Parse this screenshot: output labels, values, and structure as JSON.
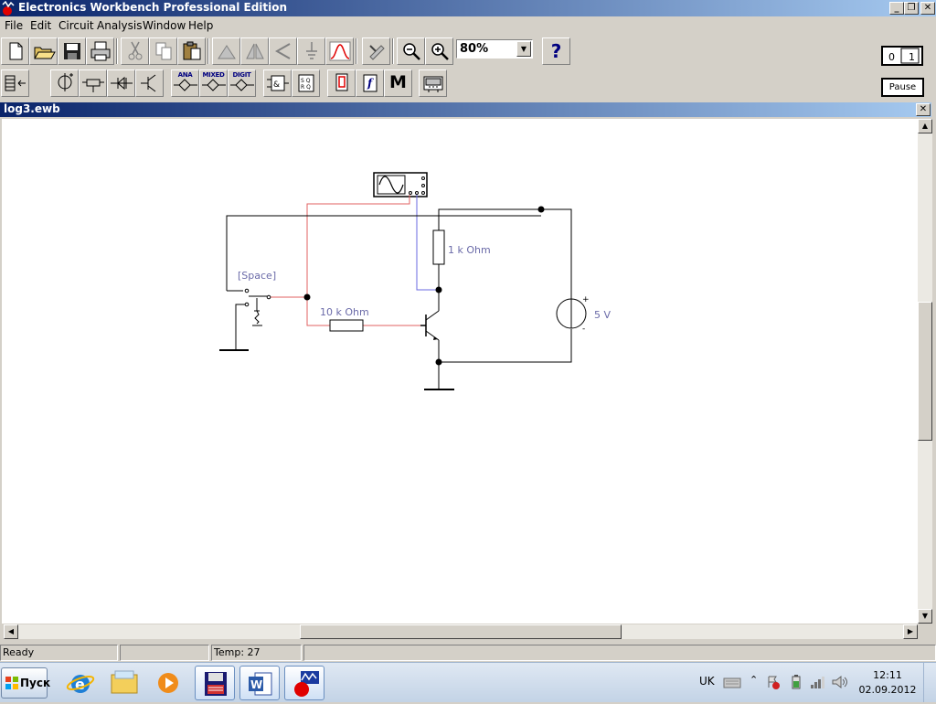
{
  "app": {
    "title": "Electronics Workbench Professional Edition",
    "window_buttons": [
      "_",
      "❐",
      "✕"
    ]
  },
  "menu": [
    "File",
    "Edit",
    "Circuit",
    "Analysis",
    "Window",
    "Help"
  ],
  "toolbar": {
    "zoom_value": "80%",
    "help_label": "?",
    "parts_bin_labels": {
      "analog": "ANA",
      "mixed": "MIXED",
      "digital": "DIGIT",
      "misc": "M"
    },
    "pause_label": "Pause",
    "power_label": "0 1"
  },
  "document": {
    "title": "log3.ewb",
    "close_label": "✕"
  },
  "circuit": {
    "switch_key": "[Space]",
    "base_resistor": "10 k Ohm",
    "collector_resistor": "1 k Ohm",
    "source_voltage": "5 V",
    "plus": "+",
    "minus": "-"
  },
  "status": {
    "ready": "Ready",
    "temp": "Temp:  27"
  },
  "taskbar": {
    "start_label": "Пуск",
    "language": "UK",
    "time": "12:11",
    "date": "02.09.2012"
  }
}
